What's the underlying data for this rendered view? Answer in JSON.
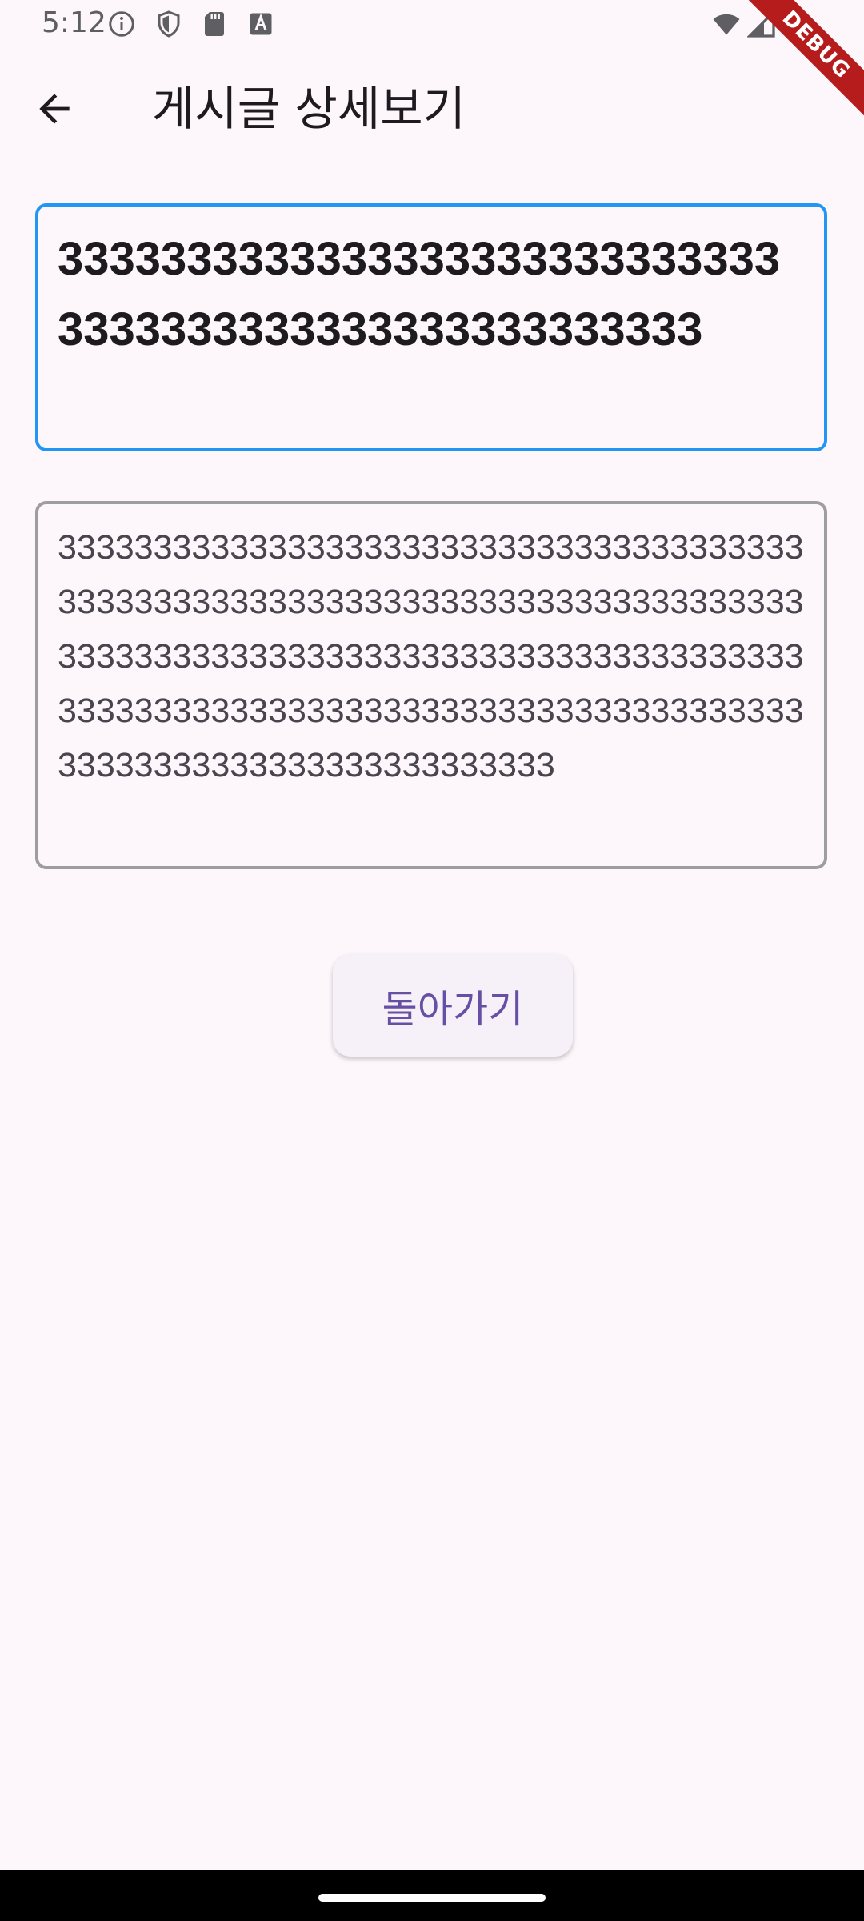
{
  "status_bar": {
    "time": "5:12",
    "icons": [
      "info-icon",
      "shield-icon",
      "sd-card-icon",
      "font-icon",
      "wifi-icon",
      "signal-icon",
      "battery-icon"
    ]
  },
  "debug_banner": "DEBUG",
  "app_bar": {
    "back_icon": "arrow-back-icon",
    "title": "게시글 상세보기"
  },
  "post": {
    "title": "33333333333333333333333333333333333333333333333333333",
    "content": "33333333333333333333333333333333333333333333333333333333333333333333333333333333333333333333333333333333333333333333333333333333333333333333333333333333333333333333333333333333333333"
  },
  "actions": {
    "back_label": "돌아가기"
  },
  "colors": {
    "background": "#fdf7fc",
    "title_border": "#2196f3",
    "content_border": "#9e9e9e",
    "button_text": "#6750a4"
  }
}
